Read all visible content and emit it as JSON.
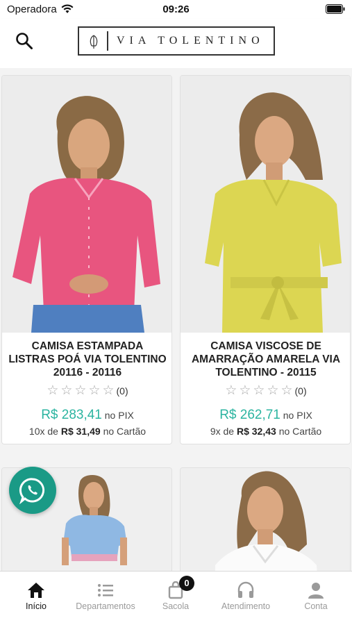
{
  "status_bar": {
    "carrier": "Operadora",
    "time": "09:26"
  },
  "header": {
    "brand": "VIA TOLENTINO",
    "icons": [
      "search-icon",
      "brand-logo"
    ]
  },
  "colors": {
    "price_green": "#2bb4a0",
    "whatsapp_green": "#1a9a86",
    "tab_active": "#111111",
    "tab_inactive": "#9a9a9a"
  },
  "products": [
    {
      "name": "CAMISA ESTAMPADA LISTRAS POÁ VIA TOLENTINO 20116 - 20116",
      "rating_count": "(0)",
      "pix_price": "R$ 283,41",
      "pix_label": "no PIX",
      "installments_count": "10x de",
      "installment_value": "R$ 31,49",
      "installment_label": "no Cartão"
    },
    {
      "name": "CAMISA VISCOSE DE AMARRAÇÃO AMARELA VIA TOLENTINO - 20115",
      "rating_count": "(0)",
      "pix_price": "R$ 262,71",
      "pix_label": "no PIX",
      "installments_count": "9x de",
      "installment_value": "R$ 32,43",
      "installment_label": "no Cartão"
    }
  ],
  "tabbar": {
    "tabs": [
      {
        "label": "Início",
        "icon": "home-icon",
        "active": true
      },
      {
        "label": "Departamentos",
        "icon": "list-icon",
        "active": false
      },
      {
        "label": "Sacola",
        "icon": "bag-icon",
        "active": false,
        "badge": "0"
      },
      {
        "label": "Atendimento",
        "icon": "headset-icon",
        "active": false
      },
      {
        "label": "Conta",
        "icon": "user-icon",
        "active": false
      }
    ]
  }
}
